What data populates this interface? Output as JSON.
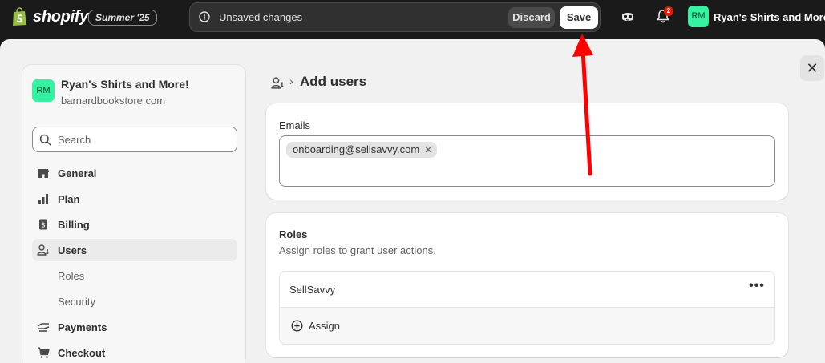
{
  "topbar": {
    "logo_text": "shopify",
    "edition": "Summer '25",
    "savebar": {
      "message": "Unsaved changes",
      "discard_label": "Discard",
      "save_label": "Save"
    },
    "notifications_count": "2",
    "store_initials": "RM",
    "store_name": "Ryan's Shirts and More!"
  },
  "settings": {
    "close_label": "✕",
    "store": {
      "initials": "RM",
      "name": "Ryan's Shirts and More!",
      "domain": "barnardbookstore.com"
    },
    "search": {
      "placeholder": "Search"
    },
    "nav": [
      {
        "label": "General",
        "icon": "store-icon"
      },
      {
        "label": "Plan",
        "icon": "plan-icon"
      },
      {
        "label": "Billing",
        "icon": "billing-icon"
      },
      {
        "label": "Users",
        "icon": "users-icon",
        "active": true
      },
      {
        "label": "Roles",
        "sub": true
      },
      {
        "label": "Security",
        "sub": true
      },
      {
        "label": "Payments",
        "icon": "payments-icon"
      },
      {
        "label": "Checkout",
        "icon": "cart-icon"
      }
    ]
  },
  "main": {
    "breadcrumb_separator": "›",
    "page_title": "Add users",
    "emails": {
      "label": "Emails",
      "tags": [
        "onboarding@sellsavvy.com"
      ],
      "remove_glyph": "✕"
    },
    "roles": {
      "title": "Roles",
      "subtitle": "Assign roles to grant user actions.",
      "assigned": [
        {
          "name": "SellSavvy"
        }
      ],
      "more_glyph": "•••",
      "assign_label": "Assign"
    }
  },
  "colors": {
    "topbar_bg": "#1a1a1a",
    "modal_bg": "#f1f1f1",
    "avatar_green": "#36f1a0",
    "badge_red": "#e51c00",
    "annotation_red": "#ff0000"
  }
}
